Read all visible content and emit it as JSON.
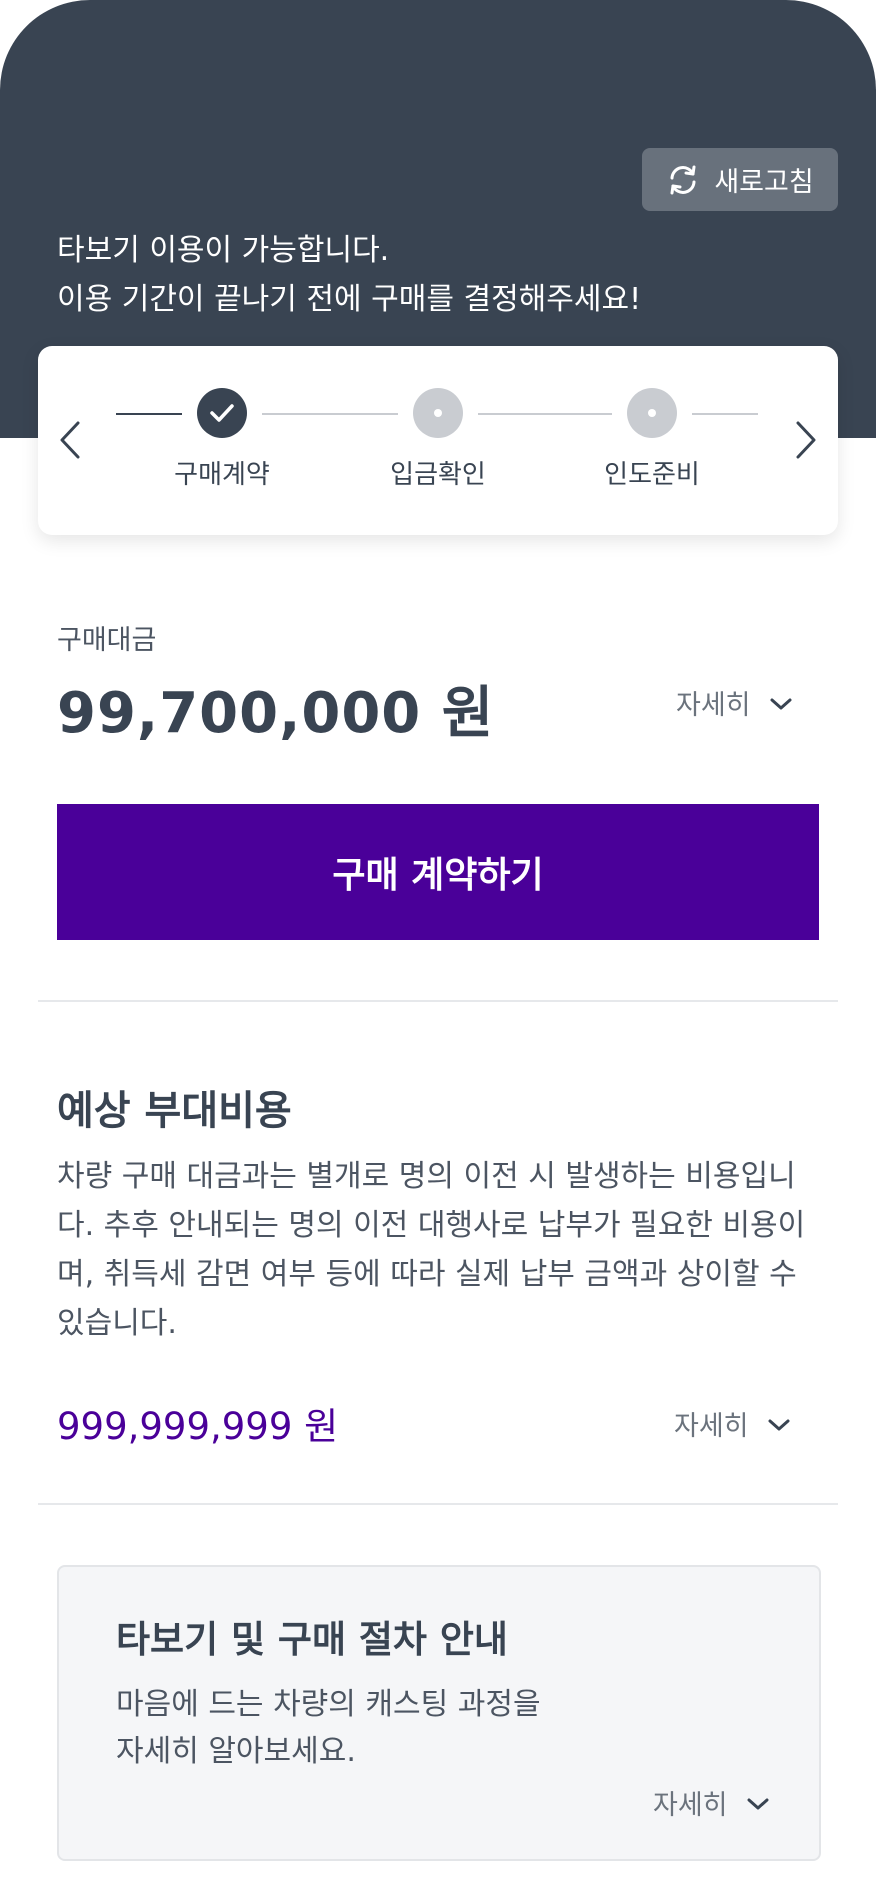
{
  "header": {
    "refresh_label": "새로고침",
    "message_line1": "타보기 이용이 가능합니다.",
    "message_line2": "이용 기간이 끝나기 전에 구매를 결정해주세요!"
  },
  "stepper": {
    "steps": [
      {
        "label": "구매계약",
        "status": "completed"
      },
      {
        "label": "입금확인",
        "status": "pending"
      },
      {
        "label": "인도준비",
        "status": "pending"
      }
    ]
  },
  "price": {
    "label": "구매대금",
    "value": "99,700,000 원",
    "detail_label": "자세히"
  },
  "cta": {
    "label": "구매 계약하기"
  },
  "extra_costs": {
    "title": "예상 부대비용",
    "description": "차량 구매 대금과는 별개로 명의 이전 시 발생하는 비용입니다. 추후 안내되는 명의 이전 대행사로 납부가 필요한 비용이며, 취득세 감면 여부 등에 따라 실제 납부 금액과 상이할 수 있습니다.",
    "amount": "999,999,999 원",
    "detail_label": "자세히"
  },
  "guide": {
    "title": "타보기 및 구매 절차 안내",
    "desc_line1": "마음에 드는 차량의 캐스팅 과정을",
    "desc_line2": "자세히 알아보세요.",
    "detail_label": "자세히"
  },
  "colors": {
    "header_bg": "#394452",
    "accent": "#4a0099",
    "step_inactive": "#c9ccd1"
  }
}
